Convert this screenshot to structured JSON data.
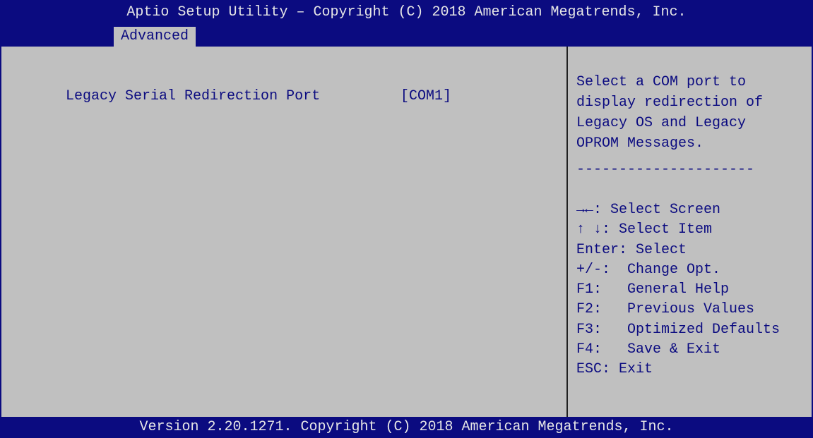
{
  "header": {
    "title": "Aptio Setup Utility – Copyright (C) 2018 American Megatrends, Inc."
  },
  "tabs": [
    {
      "label": "Advanced",
      "active": true
    }
  ],
  "settings": [
    {
      "label": "Legacy Serial Redirection Port",
      "value": "[COM1]"
    }
  ],
  "help": {
    "description": "Select a COM port to\ndisplay redirection of\nLegacy OS and Legacy\nOPROM Messages.",
    "separator": "---------------------",
    "keys": [
      "→←: Select Screen",
      "↑ ↓: Select Item",
      "Enter: Select",
      "+/-:  Change Opt.",
      "F1:   General Help",
      "F2:   Previous Values",
      "F3:   Optimized Defaults",
      "F4:   Save & Exit",
      "ESC: Exit"
    ]
  },
  "footer": {
    "version": "Version 2.20.1271. Copyright (C) 2018 American Megatrends, Inc."
  },
  "colors": {
    "bar_background": "#0b0b80",
    "pane_background": "#c0c0c0",
    "bar_text": "#e6e6e6",
    "pane_text": "#0b0b80"
  }
}
